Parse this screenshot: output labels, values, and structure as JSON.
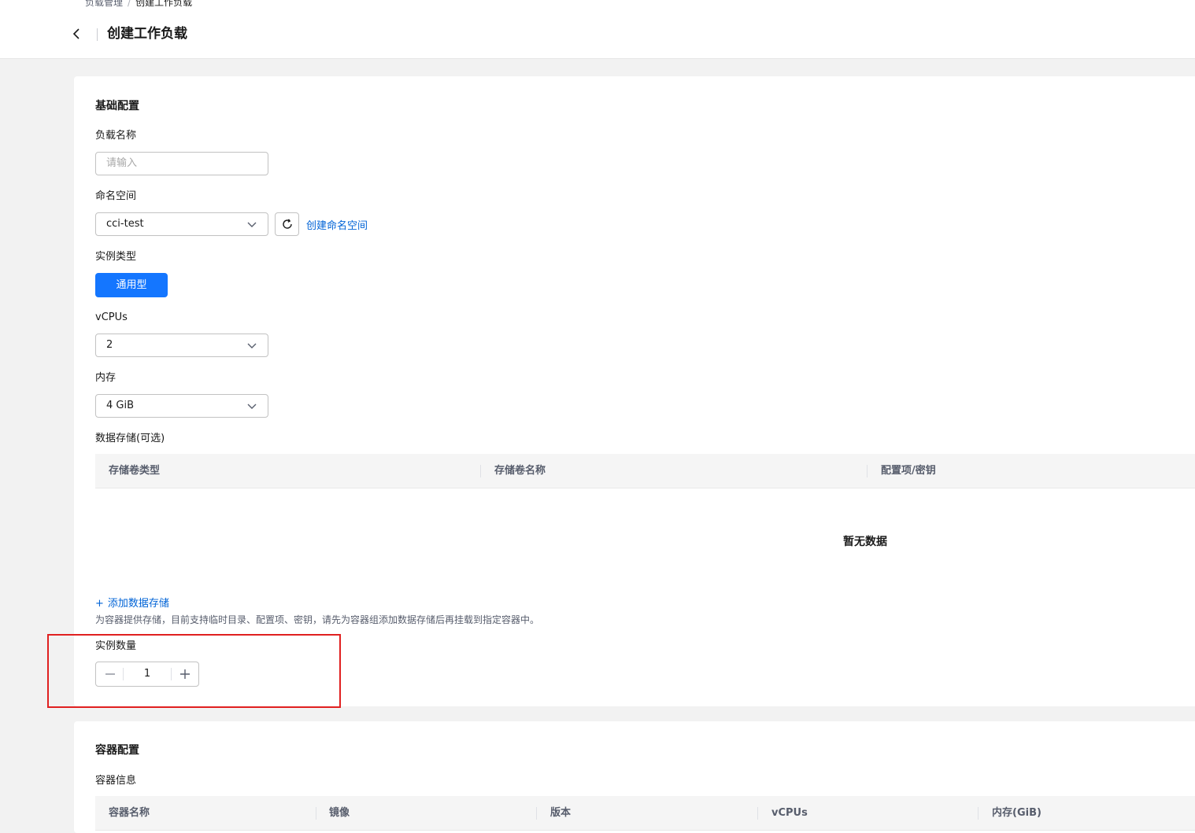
{
  "breadcrumb": {
    "parent": "负载管理",
    "separator": "/",
    "current": "创建工作负载"
  },
  "header": {
    "title": "创建工作负载"
  },
  "basic": {
    "title": "基础配置",
    "name": {
      "label": "负载名称",
      "placeholder": "请输入"
    },
    "namespace": {
      "label": "命名空间",
      "value": "cci-test",
      "create_link": "创建命名空间"
    },
    "instance_type": {
      "label": "实例类型",
      "selected": "通用型"
    },
    "vcpus": {
      "label": "vCPUs",
      "value": "2"
    },
    "memory": {
      "label": "内存",
      "value": "4 GiB"
    },
    "storage": {
      "label": "数据存储(可选)",
      "columns": [
        "存储卷类型",
        "存储卷名称",
        "配置项/密钥"
      ],
      "empty": "暂无数据",
      "add_icon": "+",
      "add_link": "添加数据存储",
      "hint": "为容器提供存储，目前支持临时目录、配置项、密钥，请先为容器组添加数据存储后再挂载到指定容器中。"
    },
    "replicas": {
      "label": "实例数量",
      "value": "1"
    }
  },
  "container": {
    "title": "容器配置",
    "info_label": "容器信息",
    "columns": [
      "容器名称",
      "镜像",
      "版本",
      "vCPUs",
      "内存(GiB)"
    ]
  },
  "colors": {
    "primary": "#1476ff",
    "link": "#0063d6",
    "highlight": "#e02020"
  }
}
